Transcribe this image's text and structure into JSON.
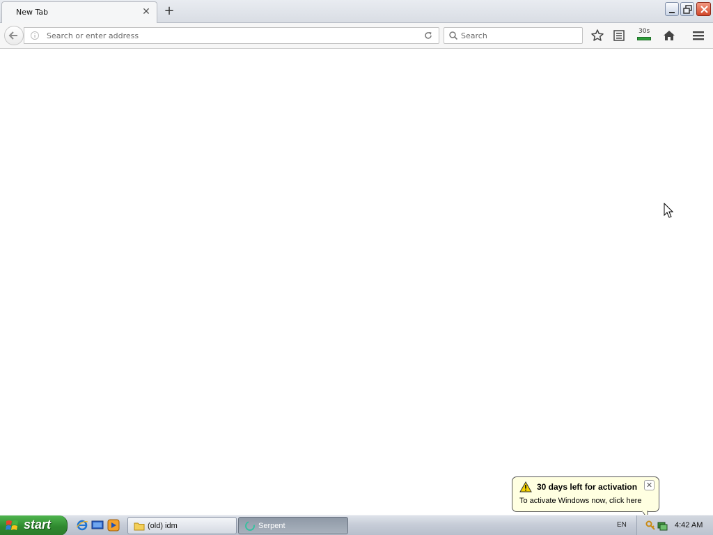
{
  "browser": {
    "tab": {
      "title": "New Tab",
      "close_icon": "close-icon"
    },
    "new_tab_icon": "plus-icon",
    "window_controls": [
      "minimize-icon",
      "restore-icon",
      "close-icon"
    ],
    "address_bar": {
      "placeholder": "Search or enter address",
      "value": ""
    },
    "search_bar": {
      "placeholder": "Search",
      "value": ""
    },
    "toolbar": {
      "bookmark_icon": "star-icon",
      "reader_icon": "reading-list-icon",
      "timer_label": "30s",
      "home_icon": "home-icon",
      "menu_icon": "hamburger-menu-icon"
    }
  },
  "notification": {
    "title": "30 days left for activation",
    "message": "To activate Windows now, click here",
    "icon": "warning-icon"
  },
  "taskbar": {
    "start_label": "start",
    "quick_launch": [
      "internet-explorer-icon",
      "show-desktop-icon",
      "media-player-icon"
    ],
    "tasks": [
      {
        "label": "(old) idm",
        "icon": "folder-icon",
        "active": false
      },
      {
        "label": "Serpent",
        "icon": "serpent-browser-icon",
        "active": true
      }
    ],
    "language": "EN",
    "clock": "4:42 AM"
  },
  "colors": {
    "start_green": "#2f8a2f",
    "balloon_bg": "#ffffe1",
    "close_red": "#d2472a"
  }
}
